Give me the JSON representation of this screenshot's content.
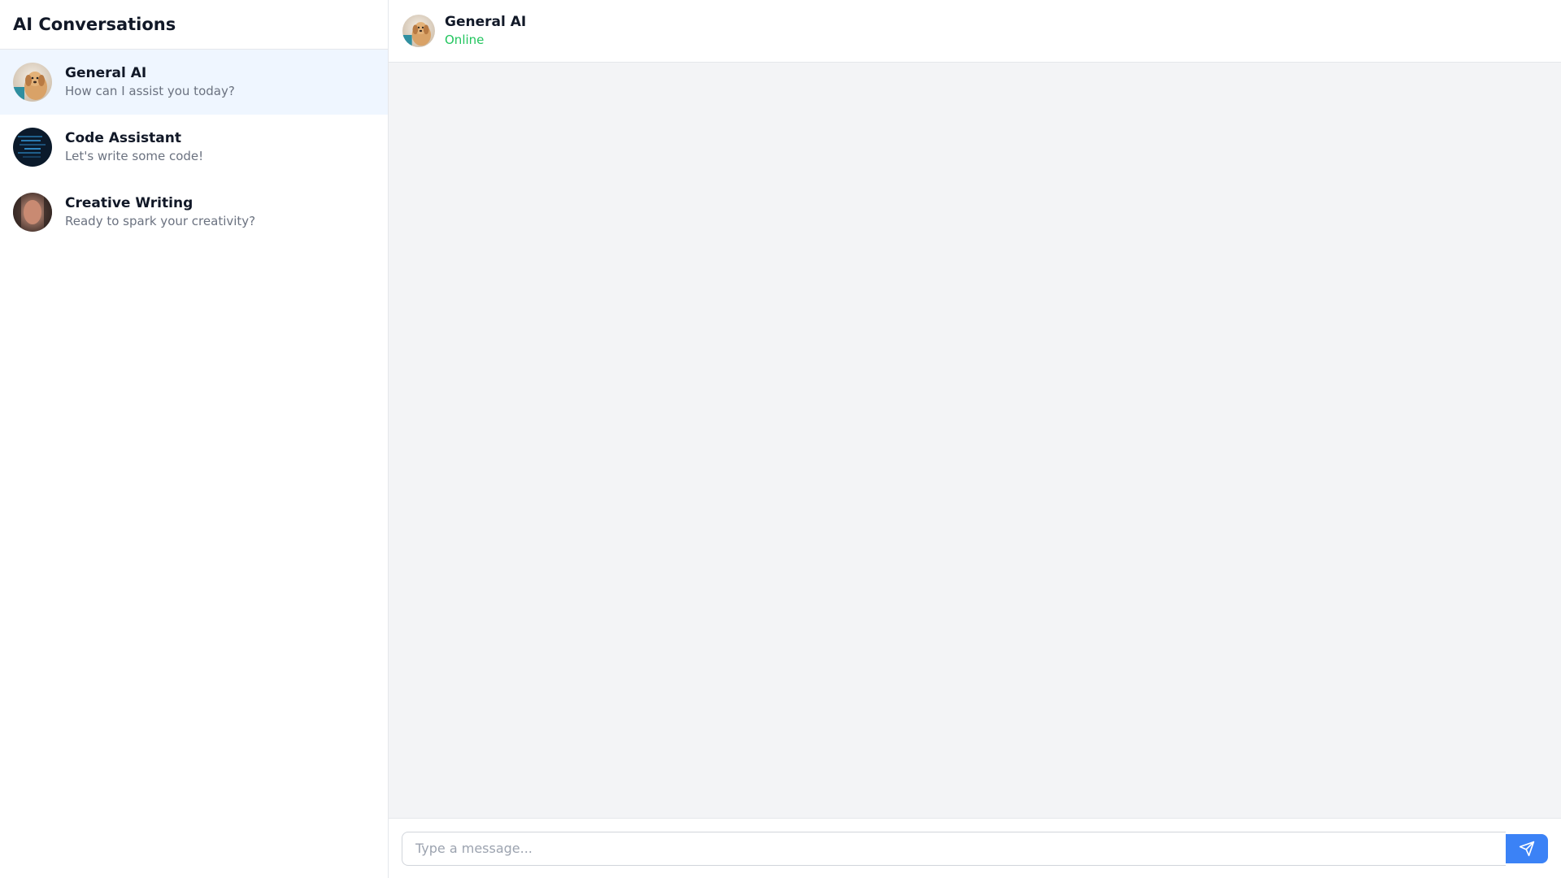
{
  "sidebar": {
    "title": "AI Conversations",
    "items": [
      {
        "name": "General AI",
        "preview": "How can I assist you today?",
        "active": true,
        "avatar": "dog-photo-avatar"
      },
      {
        "name": "Code Assistant",
        "preview": "Let's write some code!",
        "active": false,
        "avatar": "code-screen-avatar"
      },
      {
        "name": "Creative Writing",
        "preview": "Ready to spark your creativity?",
        "active": false,
        "avatar": "person-photo-avatar"
      }
    ]
  },
  "chat": {
    "header": {
      "name": "General AI",
      "status": "Online"
    },
    "composer": {
      "placeholder": "Type a message...",
      "send_icon": "paper-plane-icon"
    }
  },
  "colors": {
    "accent": "#3b82f6",
    "online": "#22c55e",
    "active_item_bg": "#eff6ff",
    "chat_bg": "#f3f4f6"
  }
}
